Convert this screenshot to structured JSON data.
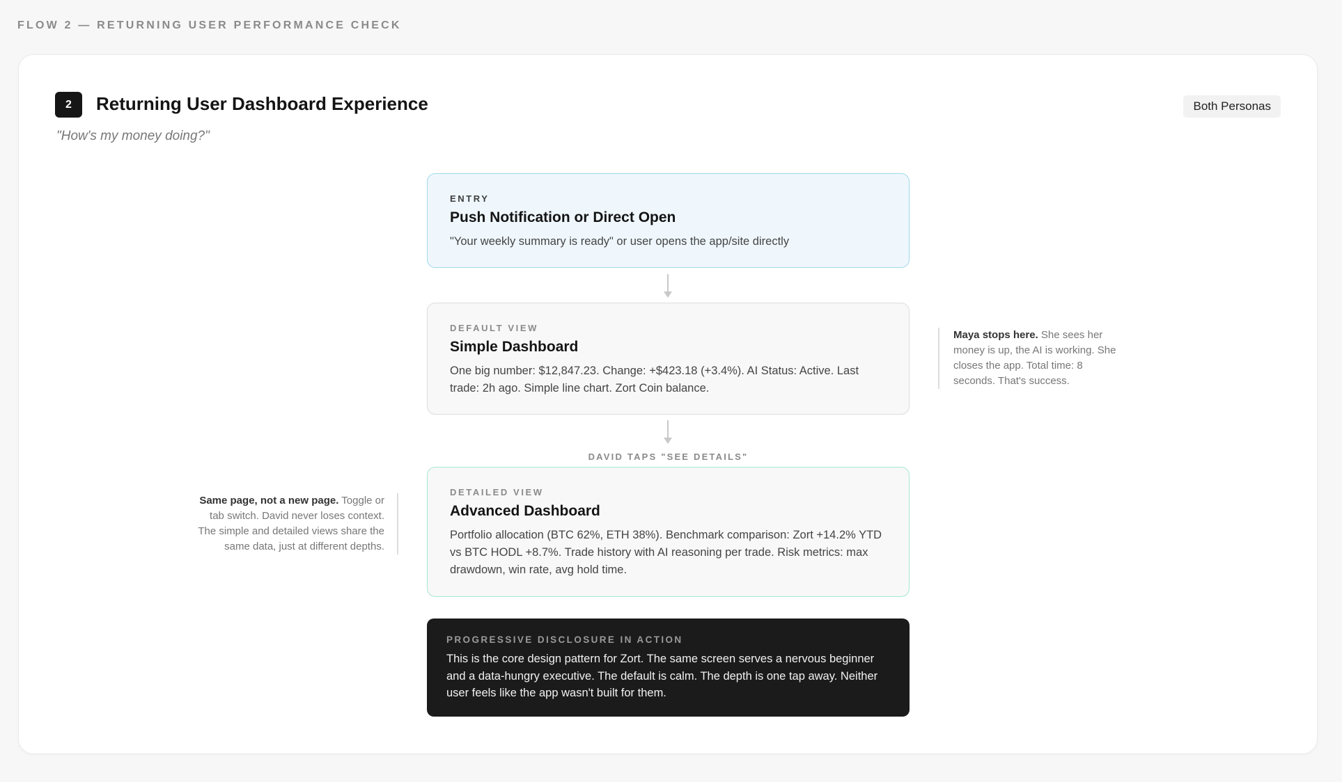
{
  "page": {
    "label": "FLOW 2 — RETURNING USER PERFORMANCE CHECK"
  },
  "flow": {
    "number": "2",
    "title": "Returning User Dashboard Experience",
    "persona_badge": "Both Personas",
    "quote": "\"How's my money doing?\""
  },
  "steps": [
    {
      "kicker": "ENTRY",
      "title": "Push Notification or Direct Open",
      "body": "\"Your weekly summary is ready\" or user opens the app/site directly"
    },
    {
      "kicker": "DEFAULT VIEW",
      "title": "Simple Dashboard",
      "body": "One big number: $12,847.23. Change: +$423.18 (+3.4%). AI Status: Active. Last trade: 2h ago. Simple line chart. Zort Coin balance."
    },
    {
      "kicker": "DETAILED VIEW",
      "title": "Advanced Dashboard",
      "body": "Portfolio allocation (BTC 62%, ETH 38%). Benchmark comparison: Zort +14.2% YTD vs BTC HODL +8.7%. Trade history with AI reasoning per trade. Risk metrics: max drawdown, win rate, avg hold time."
    }
  ],
  "transition": {
    "label": "DAVID TAPS \"SEE DETAILS\""
  },
  "annotations": {
    "right": {
      "strong": "Maya stops here.",
      "text": " She sees her money is up, the AI is working. She closes the app. Total time: 8 seconds. That's success."
    },
    "left": {
      "strong": "Same page, not a new page.",
      "text": " Toggle or tab switch. David never loses context. The simple and detailed views share the same data, just at different depths."
    }
  },
  "callout": {
    "kicker": "PROGRESSIVE DISCLOSURE IN ACTION",
    "body": "This is the core design pattern for Zort. The same screen serves a nervous beginner and a data-hungry executive. The default is calm. The depth is one tap away. Neither user feels like the app wasn't built for them."
  }
}
